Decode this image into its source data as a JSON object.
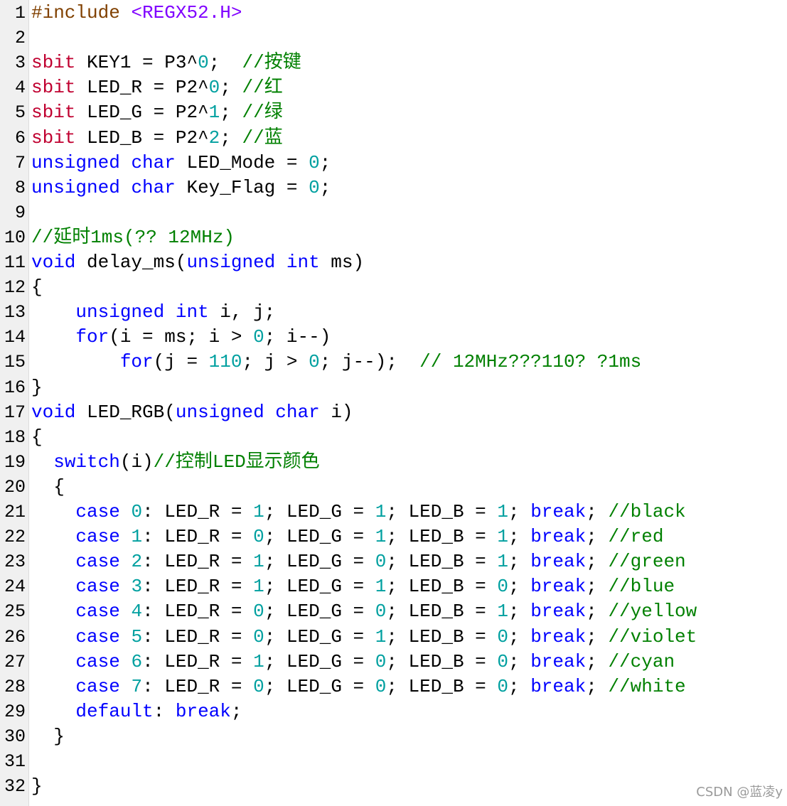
{
  "editor": {
    "lines": [
      {
        "n": "1",
        "tokens": [
          {
            "t": "#include ",
            "c": "pre"
          },
          {
            "t": "<REGX52.H>",
            "c": "str"
          }
        ]
      },
      {
        "n": "2",
        "tokens": []
      },
      {
        "n": "3",
        "tokens": [
          {
            "t": "sbit",
            "c": "sbit"
          },
          {
            "t": " KEY1 = P3^",
            "c": "id"
          },
          {
            "t": "0",
            "c": "num"
          },
          {
            "t": ";  ",
            "c": "id"
          },
          {
            "t": "//按键",
            "c": "cmt"
          }
        ]
      },
      {
        "n": "4",
        "tokens": [
          {
            "t": "sbit",
            "c": "sbit"
          },
          {
            "t": " LED_R = P2^",
            "c": "id"
          },
          {
            "t": "0",
            "c": "num"
          },
          {
            "t": "; ",
            "c": "id"
          },
          {
            "t": "//红",
            "c": "cmt"
          }
        ]
      },
      {
        "n": "5",
        "tokens": [
          {
            "t": "sbit",
            "c": "sbit"
          },
          {
            "t": " LED_G = P2^",
            "c": "id"
          },
          {
            "t": "1",
            "c": "num"
          },
          {
            "t": "; ",
            "c": "id"
          },
          {
            "t": "//绿",
            "c": "cmt"
          }
        ]
      },
      {
        "n": "6",
        "tokens": [
          {
            "t": "sbit",
            "c": "sbit"
          },
          {
            "t": " LED_B = P2^",
            "c": "id"
          },
          {
            "t": "2",
            "c": "num"
          },
          {
            "t": "; ",
            "c": "id"
          },
          {
            "t": "//蓝",
            "c": "cmt"
          }
        ]
      },
      {
        "n": "7",
        "tokens": [
          {
            "t": "unsigned",
            "c": "kw"
          },
          {
            "t": " ",
            "c": "id"
          },
          {
            "t": "char",
            "c": "kw"
          },
          {
            "t": " LED_Mode = ",
            "c": "id"
          },
          {
            "t": "0",
            "c": "num"
          },
          {
            "t": ";",
            "c": "id"
          }
        ]
      },
      {
        "n": "8",
        "tokens": [
          {
            "t": "unsigned",
            "c": "kw"
          },
          {
            "t": " ",
            "c": "id"
          },
          {
            "t": "char",
            "c": "kw"
          },
          {
            "t": " Key_Flag = ",
            "c": "id"
          },
          {
            "t": "0",
            "c": "num"
          },
          {
            "t": ";",
            "c": "id"
          }
        ]
      },
      {
        "n": "9",
        "tokens": []
      },
      {
        "n": "10",
        "tokens": [
          {
            "t": "//延时1ms(?? 12MHz)",
            "c": "cmt"
          }
        ]
      },
      {
        "n": "11",
        "tokens": [
          {
            "t": "void",
            "c": "kw"
          },
          {
            "t": " delay_ms(",
            "c": "id"
          },
          {
            "t": "unsigned",
            "c": "kw"
          },
          {
            "t": " ",
            "c": "id"
          },
          {
            "t": "int",
            "c": "kw"
          },
          {
            "t": " ms)",
            "c": "id"
          }
        ]
      },
      {
        "n": "12",
        "tokens": [
          {
            "t": "{",
            "c": "id"
          }
        ]
      },
      {
        "n": "13",
        "tokens": [
          {
            "t": "    ",
            "c": "id"
          },
          {
            "t": "unsigned",
            "c": "kw"
          },
          {
            "t": " ",
            "c": "id"
          },
          {
            "t": "int",
            "c": "kw"
          },
          {
            "t": " i, j;",
            "c": "id"
          }
        ]
      },
      {
        "n": "14",
        "tokens": [
          {
            "t": "    ",
            "c": "id"
          },
          {
            "t": "for",
            "c": "kw"
          },
          {
            "t": "(i = ms; i > ",
            "c": "id"
          },
          {
            "t": "0",
            "c": "num"
          },
          {
            "t": "; i--)",
            "c": "id"
          }
        ]
      },
      {
        "n": "15",
        "tokens": [
          {
            "t": "        ",
            "c": "id"
          },
          {
            "t": "for",
            "c": "kw"
          },
          {
            "t": "(j = ",
            "c": "id"
          },
          {
            "t": "110",
            "c": "num"
          },
          {
            "t": "; j > ",
            "c": "id"
          },
          {
            "t": "0",
            "c": "num"
          },
          {
            "t": "; j--);  ",
            "c": "id"
          },
          {
            "t": "// 12MHz???110? ?1ms",
            "c": "cmt"
          }
        ]
      },
      {
        "n": "16",
        "tokens": [
          {
            "t": "}",
            "c": "id"
          }
        ]
      },
      {
        "n": "17",
        "tokens": [
          {
            "t": "void",
            "c": "kw"
          },
          {
            "t": " LED_RGB(",
            "c": "id"
          },
          {
            "t": "unsigned",
            "c": "kw"
          },
          {
            "t": " ",
            "c": "id"
          },
          {
            "t": "char",
            "c": "kw"
          },
          {
            "t": " i)",
            "c": "id"
          }
        ]
      },
      {
        "n": "18",
        "tokens": [
          {
            "t": "{",
            "c": "id"
          }
        ]
      },
      {
        "n": "19",
        "tokens": [
          {
            "t": "  ",
            "c": "id"
          },
          {
            "t": "switch",
            "c": "kw"
          },
          {
            "t": "(i)",
            "c": "id"
          },
          {
            "t": "//控制LED显示颜色",
            "c": "cmt"
          }
        ]
      },
      {
        "n": "20",
        "tokens": [
          {
            "t": "  {",
            "c": "id"
          }
        ]
      },
      {
        "n": "21",
        "tokens": [
          {
            "t": "    ",
            "c": "id"
          },
          {
            "t": "case",
            "c": "kw"
          },
          {
            "t": " ",
            "c": "id"
          },
          {
            "t": "0",
            "c": "num"
          },
          {
            "t": ": LED_R = ",
            "c": "id"
          },
          {
            "t": "1",
            "c": "num"
          },
          {
            "t": "; LED_G = ",
            "c": "id"
          },
          {
            "t": "1",
            "c": "num"
          },
          {
            "t": "; LED_B = ",
            "c": "id"
          },
          {
            "t": "1",
            "c": "num"
          },
          {
            "t": "; ",
            "c": "id"
          },
          {
            "t": "break",
            "c": "kw"
          },
          {
            "t": "; ",
            "c": "id"
          },
          {
            "t": "//black",
            "c": "cmt"
          }
        ]
      },
      {
        "n": "22",
        "tokens": [
          {
            "t": "    ",
            "c": "id"
          },
          {
            "t": "case",
            "c": "kw"
          },
          {
            "t": " ",
            "c": "id"
          },
          {
            "t": "1",
            "c": "num"
          },
          {
            "t": ": LED_R = ",
            "c": "id"
          },
          {
            "t": "0",
            "c": "num"
          },
          {
            "t": "; LED_G = ",
            "c": "id"
          },
          {
            "t": "1",
            "c": "num"
          },
          {
            "t": "; LED_B = ",
            "c": "id"
          },
          {
            "t": "1",
            "c": "num"
          },
          {
            "t": "; ",
            "c": "id"
          },
          {
            "t": "break",
            "c": "kw"
          },
          {
            "t": "; ",
            "c": "id"
          },
          {
            "t": "//red",
            "c": "cmt"
          }
        ]
      },
      {
        "n": "23",
        "tokens": [
          {
            "t": "    ",
            "c": "id"
          },
          {
            "t": "case",
            "c": "kw"
          },
          {
            "t": " ",
            "c": "id"
          },
          {
            "t": "2",
            "c": "num"
          },
          {
            "t": ": LED_R = ",
            "c": "id"
          },
          {
            "t": "1",
            "c": "num"
          },
          {
            "t": "; LED_G = ",
            "c": "id"
          },
          {
            "t": "0",
            "c": "num"
          },
          {
            "t": "; LED_B = ",
            "c": "id"
          },
          {
            "t": "1",
            "c": "num"
          },
          {
            "t": "; ",
            "c": "id"
          },
          {
            "t": "break",
            "c": "kw"
          },
          {
            "t": "; ",
            "c": "id"
          },
          {
            "t": "//green",
            "c": "cmt"
          }
        ]
      },
      {
        "n": "24",
        "tokens": [
          {
            "t": "    ",
            "c": "id"
          },
          {
            "t": "case",
            "c": "kw"
          },
          {
            "t": " ",
            "c": "id"
          },
          {
            "t": "3",
            "c": "num"
          },
          {
            "t": ": LED_R = ",
            "c": "id"
          },
          {
            "t": "1",
            "c": "num"
          },
          {
            "t": "; LED_G = ",
            "c": "id"
          },
          {
            "t": "1",
            "c": "num"
          },
          {
            "t": "; LED_B = ",
            "c": "id"
          },
          {
            "t": "0",
            "c": "num"
          },
          {
            "t": "; ",
            "c": "id"
          },
          {
            "t": "break",
            "c": "kw"
          },
          {
            "t": "; ",
            "c": "id"
          },
          {
            "t": "//blue",
            "c": "cmt"
          }
        ]
      },
      {
        "n": "25",
        "tokens": [
          {
            "t": "    ",
            "c": "id"
          },
          {
            "t": "case",
            "c": "kw"
          },
          {
            "t": " ",
            "c": "id"
          },
          {
            "t": "4",
            "c": "num"
          },
          {
            "t": ": LED_R = ",
            "c": "id"
          },
          {
            "t": "0",
            "c": "num"
          },
          {
            "t": "; LED_G = ",
            "c": "id"
          },
          {
            "t": "0",
            "c": "num"
          },
          {
            "t": "; LED_B = ",
            "c": "id"
          },
          {
            "t": "1",
            "c": "num"
          },
          {
            "t": "; ",
            "c": "id"
          },
          {
            "t": "break",
            "c": "kw"
          },
          {
            "t": "; ",
            "c": "id"
          },
          {
            "t": "//yellow",
            "c": "cmt"
          }
        ]
      },
      {
        "n": "26",
        "tokens": [
          {
            "t": "    ",
            "c": "id"
          },
          {
            "t": "case",
            "c": "kw"
          },
          {
            "t": " ",
            "c": "id"
          },
          {
            "t": "5",
            "c": "num"
          },
          {
            "t": ": LED_R = ",
            "c": "id"
          },
          {
            "t": "0",
            "c": "num"
          },
          {
            "t": "; LED_G = ",
            "c": "id"
          },
          {
            "t": "1",
            "c": "num"
          },
          {
            "t": "; LED_B = ",
            "c": "id"
          },
          {
            "t": "0",
            "c": "num"
          },
          {
            "t": "; ",
            "c": "id"
          },
          {
            "t": "break",
            "c": "kw"
          },
          {
            "t": "; ",
            "c": "id"
          },
          {
            "t": "//violet",
            "c": "cmt"
          }
        ]
      },
      {
        "n": "27",
        "tokens": [
          {
            "t": "    ",
            "c": "id"
          },
          {
            "t": "case",
            "c": "kw"
          },
          {
            "t": " ",
            "c": "id"
          },
          {
            "t": "6",
            "c": "num"
          },
          {
            "t": ": LED_R = ",
            "c": "id"
          },
          {
            "t": "1",
            "c": "num"
          },
          {
            "t": "; LED_G = ",
            "c": "id"
          },
          {
            "t": "0",
            "c": "num"
          },
          {
            "t": "; LED_B = ",
            "c": "id"
          },
          {
            "t": "0",
            "c": "num"
          },
          {
            "t": "; ",
            "c": "id"
          },
          {
            "t": "break",
            "c": "kw"
          },
          {
            "t": "; ",
            "c": "id"
          },
          {
            "t": "//cyan",
            "c": "cmt"
          }
        ]
      },
      {
        "n": "28",
        "tokens": [
          {
            "t": "    ",
            "c": "id"
          },
          {
            "t": "case",
            "c": "kw"
          },
          {
            "t": " ",
            "c": "id"
          },
          {
            "t": "7",
            "c": "num"
          },
          {
            "t": ": LED_R = ",
            "c": "id"
          },
          {
            "t": "0",
            "c": "num"
          },
          {
            "t": "; LED_G = ",
            "c": "id"
          },
          {
            "t": "0",
            "c": "num"
          },
          {
            "t": "; LED_B = ",
            "c": "id"
          },
          {
            "t": "0",
            "c": "num"
          },
          {
            "t": "; ",
            "c": "id"
          },
          {
            "t": "break",
            "c": "kw"
          },
          {
            "t": "; ",
            "c": "id"
          },
          {
            "t": "//white",
            "c": "cmt"
          }
        ]
      },
      {
        "n": "29",
        "tokens": [
          {
            "t": "    ",
            "c": "id"
          },
          {
            "t": "default",
            "c": "kw"
          },
          {
            "t": ": ",
            "c": "id"
          },
          {
            "t": "break",
            "c": "kw"
          },
          {
            "t": ";",
            "c": "id"
          }
        ]
      },
      {
        "n": "30",
        "tokens": [
          {
            "t": "  }",
            "c": "id"
          }
        ]
      },
      {
        "n": "31",
        "tokens": []
      },
      {
        "n": "32",
        "tokens": [
          {
            "t": "}",
            "c": "id"
          }
        ]
      }
    ]
  },
  "watermark": "CSDN @蓝凌y",
  "colors": {
    "background": "#ffffff",
    "gutter": "#f0f0f0",
    "keyword": "#0000ff",
    "sbit": "#c00030",
    "number": "#00a0a0",
    "comment": "#008000",
    "preprocessor": "#804000",
    "string": "#8000ff"
  }
}
